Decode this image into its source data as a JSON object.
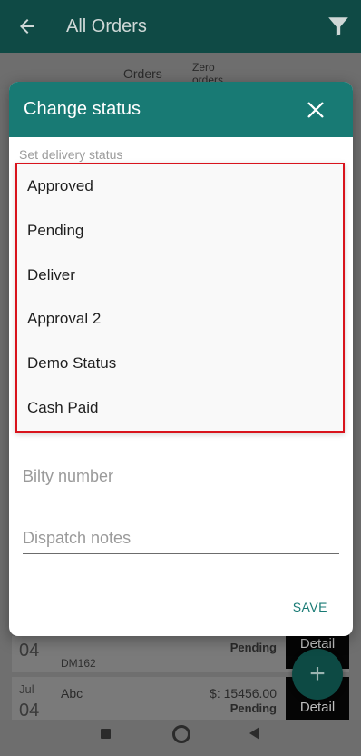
{
  "appbar": {
    "title": "All Orders",
    "back_icon": "arrow-left-icon",
    "filter_icon": "filter-icon"
  },
  "tabs": {
    "orders": "Orders",
    "zero_orders": "Zero orders"
  },
  "rows": [
    {
      "day": "04",
      "code": "DM162",
      "status": "Pending",
      "detail": "Detail"
    },
    {
      "month": "Jul",
      "day": "04",
      "name": "Abc",
      "amount": "$: 15456.00",
      "status": "Pending",
      "detail": "Detail"
    }
  ],
  "fab": {
    "label": "+"
  },
  "dialog": {
    "title": "Change status",
    "status_label": "Set delivery status",
    "options": [
      "Approved",
      "Pending",
      "Deliver",
      "Approval 2",
      "Demo Status",
      "Cash Paid"
    ],
    "bilty_placeholder": "Bilty number",
    "notes_placeholder": "Dispatch notes",
    "save_label": "SAVE"
  },
  "colors": {
    "header": "#187a74",
    "appbar": "#0f4a45",
    "highlight_border": "#d9141d"
  }
}
